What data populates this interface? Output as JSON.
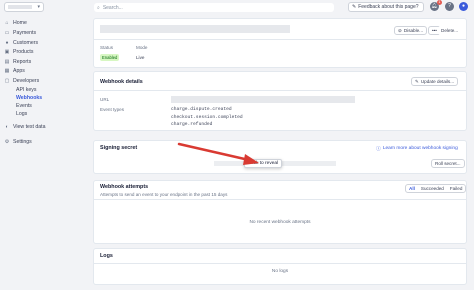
{
  "sidebar": {
    "items": [
      {
        "label": "Home",
        "icon": "home-icon"
      },
      {
        "label": "Payments",
        "icon": "payments-icon"
      },
      {
        "label": "Customers",
        "icon": "customers-icon"
      },
      {
        "label": "Products",
        "icon": "products-icon"
      },
      {
        "label": "Reports",
        "icon": "reports-icon"
      },
      {
        "label": "Apps",
        "icon": "apps-icon"
      },
      {
        "label": "Developers",
        "icon": "developers-icon"
      }
    ],
    "sub_items": [
      {
        "label": "API keys"
      },
      {
        "label": "Webhooks",
        "active": true
      },
      {
        "label": "Events"
      },
      {
        "label": "Logs"
      }
    ],
    "view_test_data": "View test data",
    "settings": "Settings"
  },
  "topbar": {
    "search_placeholder": "Search...",
    "feedback": "Feedback about this page?",
    "notification_count": "1"
  },
  "endpoint": {
    "disable_label": "Disable...",
    "delete_label": "Delete...",
    "status_label": "Status",
    "status_value": "Enabled",
    "mode_label": "Mode",
    "mode_value": "Live"
  },
  "details": {
    "title": "Webhook details",
    "update_label": "Update details...",
    "url_label": "URL",
    "event_types_label": "Event types",
    "events": [
      "charge.dispute.created",
      "checkout.session.completed",
      "charge.refunded"
    ]
  },
  "signing": {
    "title": "Signing secret",
    "learn_more": "Learn more about webhook signing",
    "reveal_label": "Click to reveal",
    "roll_label": "Roll secret..."
  },
  "attempts": {
    "title": "Webhook attempts",
    "subtitle": "Attempts to send an event to your endpoint in the past 15 days",
    "tabs": [
      "All",
      "Succeeded",
      "Failed"
    ],
    "empty": "No recent webhook attempts"
  },
  "logs": {
    "title": "Logs",
    "empty": "No logs"
  },
  "colors": {
    "accent": "#3b5bdb",
    "annotation_arrow": "#d93a32",
    "enabled_bg": "#d7f7c2"
  }
}
